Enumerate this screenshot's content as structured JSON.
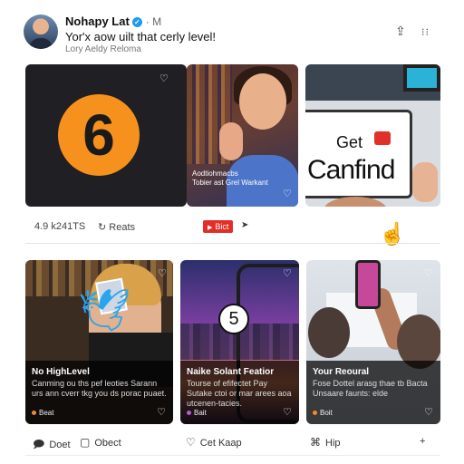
{
  "post": {
    "author_name": "Nohapy Lat",
    "time": "· M",
    "tagline": "Yor'x aow uilt that cerly level!",
    "subtitle": "Lory Aeldy Reloma"
  },
  "top_tiles": {
    "tile1_number": "6",
    "tile2_caption_line1": "Aodtiohmacbs",
    "tile2_caption_line2": "Tobier ast Grel Warkant",
    "tile3_sign_small": "Get",
    "tile3_sign_big": "Canfind"
  },
  "stats": {
    "views": "4.9 k241TS",
    "reacts": "Reats",
    "yt_label": "Bict"
  },
  "cards": [
    {
      "title": "No HighLevel",
      "desc": "Canming ou ths pef leoties Sarann urs ann cverr tkg you ds porac puaet.",
      "tag": "Beat",
      "dot_color": "#f28a2e"
    },
    {
      "title": "Naike Solant Featior",
      "desc": "Tourse of efifectet Pay Sutake ctoi or mar arees aoa utcenen-tacies.",
      "tag": "Bait",
      "dot_color": "#b55bd6",
      "number": "5"
    },
    {
      "title": "Your Reoural",
      "desc": "Fose Dottel arasg thae tb Bacta Unsaare faunts: elde",
      "tag": "Boit",
      "dot_color": "#f28a2e"
    }
  ],
  "actions": {
    "action1": "Doet",
    "action2": "Obect",
    "action3": "Cet Kaap",
    "action4": "Hip"
  }
}
